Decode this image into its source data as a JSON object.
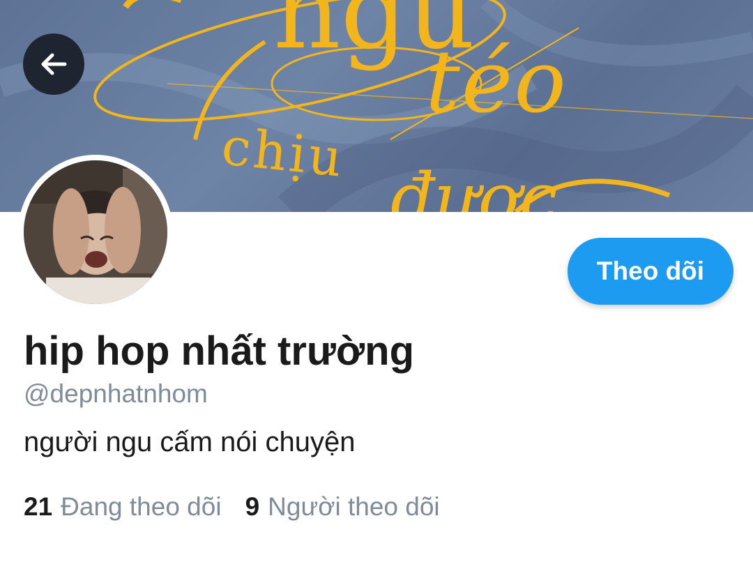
{
  "banner": {
    "words": [
      "ngu",
      "téo",
      "chịu",
      "được"
    ],
    "text_color": "#f3b51c"
  },
  "nav": {
    "back_icon": "arrow-left-icon"
  },
  "profile": {
    "follow_label": "Theo dõi",
    "display_name": "hip hop nhất trường",
    "handle": "@depnhatnhom",
    "bio": "người ngu cấm nói chuyện",
    "following_count": "21",
    "following_label": "Đang theo dõi",
    "followers_count": "9",
    "followers_label": "Người theo dõi"
  },
  "colors": {
    "accent": "#1d9bf0",
    "text_primary": "#1a1a1a",
    "text_secondary": "#7f8b96",
    "back_button_bg": "#1e2530"
  }
}
